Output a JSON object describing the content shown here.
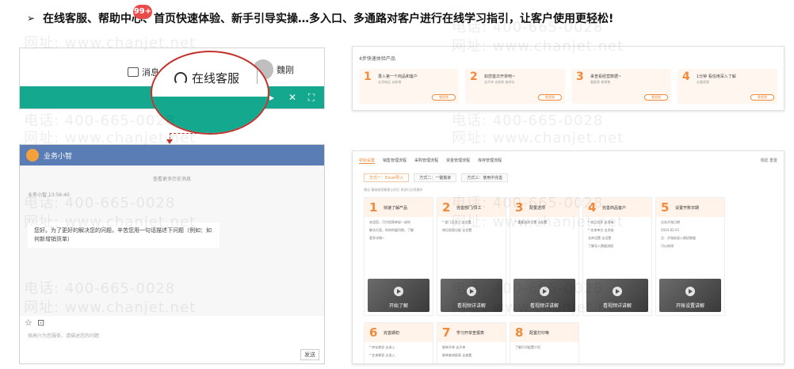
{
  "headline": {
    "bullet": "➢",
    "text": "在线客服、帮助中心、首页快速体验、新手引导实操…多入口、多通路对客户进行在线学习指引，让客户使用更轻松!"
  },
  "watermark": {
    "phone": "电话: 400-665-0028",
    "site": "网址: www.chanjet.net"
  },
  "toolbar": {
    "message_label": "消息",
    "badge_count": "99+",
    "user_name": "魏刚",
    "online_service_label": "在线客服",
    "buttons": {
      "play": "▸",
      "close": "✕",
      "expand": "⛶"
    }
  },
  "chat": {
    "title": "业务小智",
    "history_link": "查看更多历史消息",
    "sender": "业务小智 13:56:40",
    "bubble_text": "您好。为了更好的解决您的问题，辛苦您用一句话描述下问题（例如：如何新增销货单）",
    "tools": [
      "☆",
      "⊡"
    ],
    "input_placeholder": "很高兴为您服务，请描述您的问题",
    "send_label": "发送"
  },
  "quick_experience": {
    "title": "4步快速体验产品",
    "cards": [
      {
        "num": "1",
        "title": "录入第一个商品和客户",
        "sub": "去添商品  去新增",
        "button": "看视频"
      },
      {
        "num": "2",
        "title": "如您首次开单吧~",
        "sub": "去开单  去收款  查库存",
        "button": "看视频"
      },
      {
        "num": "3",
        "title": "来查看经营数据~",
        "sub": "看报表  查销售",
        "button": "看视频"
      },
      {
        "num": "4",
        "title": "1分钟 看信用深入了解",
        "sub": "去看视频",
        "button": "看视频"
      }
    ]
  },
  "guide": {
    "tabs": [
      "初始设置",
      "销售管理流程",
      "采购管理流程",
      "资金管理流程",
      "库存管理流程"
    ],
    "top_right": "收起  重置",
    "methods": [
      "方式一：Excel导入",
      "方式二：一键搬家",
      "方式三：使用中完善"
    ],
    "hint": "建议 基础档案都建立好后 再进行后续操作",
    "cards": [
      {
        "num": "1",
        "title": "快速了解产品",
        "lines": [
          "欢迎您，可为您简单说一说你",
          "解决方案，的你的疑问期，了解",
          "更多详情~"
        ],
        "video": "开始了解"
      },
      {
        "num": "2",
        "title": "完善部门/员工",
        "lines": [
          "* 部门及员工  去设置",
          "岗位权限分配  去设置"
        ],
        "video": "看视频详讲解"
      },
      {
        "num": "3",
        "title": "配置选项",
        "lines": [
          "* 重要选项设置  去配置"
        ],
        "video": "看视频详讲解"
      },
      {
        "num": "4",
        "title": "完善商品客户",
        "lines": [
          "* 商品信息  去添加",
          "* 往来单位  去添加",
          "仓库设置  去设置",
          "了解导入数据流程"
        ],
        "video": "看视频详讲解"
      },
      {
        "num": "5",
        "title": "设置开账日期",
        "lines": [
          "业务开账日期",
          "2024-02-01",
          "注：开账前录入期初数据",
          "可以修改"
        ],
        "video": "开账设置讲解"
      },
      {
        "num": "6",
        "title": "完善期初",
        "lines": [
          "* 库存期初  去录入",
          "* 往来期初  去录入"
        ],
        "video": ""
      },
      {
        "num": "7",
        "title": "学习开单查报表",
        "lines": [
          "制单开单  去开单",
          "制单查询报表  去查看"
        ],
        "video": ""
      },
      {
        "num": "8",
        "title": "配置打印等",
        "lines": [
          "了解打印配置介绍"
        ],
        "video": ""
      }
    ]
  }
}
